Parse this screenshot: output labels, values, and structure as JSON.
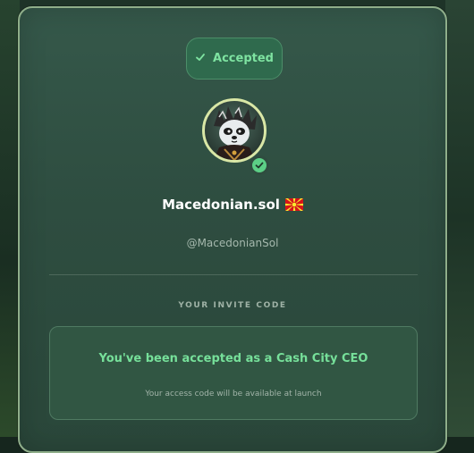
{
  "status": {
    "label": "Accepted",
    "icon": "check-icon",
    "color": "#7ee3a1"
  },
  "profile": {
    "avatar_icon": "panda-avatar",
    "verified_icon": "verified-check-icon",
    "name": "Macedonian.sol",
    "flag_icon": "north-macedonia-flag-icon",
    "handle": "@MacedonianSol"
  },
  "invite": {
    "section_label": "YOUR INVITE CODE",
    "message": "You've been accepted as a Cash City CEO",
    "note": "Your access code will be available at launch",
    "accent": "#76e09a"
  }
}
